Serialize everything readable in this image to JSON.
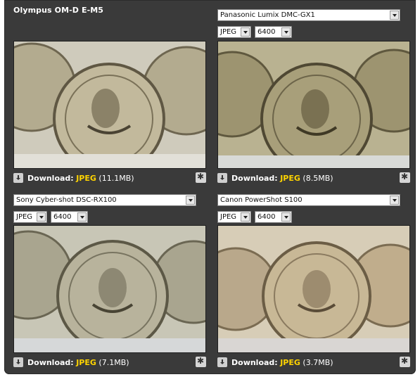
{
  "panels": [
    {
      "camera_title": "Olympus OM-D E-M5",
      "has_selector": false,
      "download": {
        "label": "Download:",
        "format": "JPEG",
        "size": "(11.1MB)"
      }
    },
    {
      "camera_select": "Panasonic Lumix DMC-GX1",
      "format_select": "JPEG",
      "iso_select": "6400",
      "download": {
        "label": "Download:",
        "format": "JPEG",
        "size": "(8.5MB)"
      }
    },
    {
      "camera_select": "Sony Cyber-shot DSC-RX100",
      "format_select": "JPEG",
      "iso_select": "6400",
      "download": {
        "label": "Download:",
        "format": "JPEG",
        "size": "(7.1MB)"
      }
    },
    {
      "camera_select": "Canon PowerShot S100",
      "format_select": "JPEG",
      "iso_select": "6400",
      "download": {
        "label": "Download:",
        "format": "JPEG",
        "size": "(3.7MB)"
      }
    }
  ]
}
